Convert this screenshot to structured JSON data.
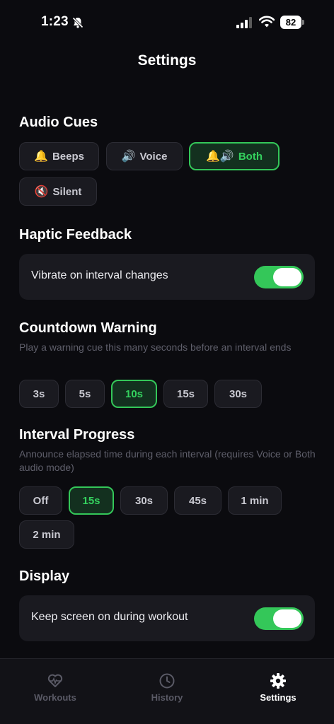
{
  "status_bar": {
    "time": "1:23",
    "battery": "82"
  },
  "header": {
    "title": "Settings"
  },
  "audio_cues": {
    "title": "Audio Cues",
    "options": [
      {
        "emoji": "🔔",
        "label": "Beeps"
      },
      {
        "emoji": "🔊",
        "label": "Voice"
      },
      {
        "emoji": "🔔🔊",
        "label": "Both"
      },
      {
        "emoji": "🔇",
        "label": "Silent"
      }
    ],
    "selected": "Both"
  },
  "haptic": {
    "title": "Haptic Feedback",
    "label": "Vibrate on interval changes",
    "enabled": true
  },
  "countdown": {
    "title": "Countdown Warning",
    "description": "Play a warning cue this many seconds before an interval ends",
    "options": [
      "3s",
      "5s",
      "10s",
      "15s",
      "30s"
    ],
    "selected": "10s"
  },
  "interval_progress": {
    "title": "Interval Progress",
    "description": "Announce elapsed time during each interval (requires Voice or Both audio mode)",
    "options": [
      "Off",
      "15s",
      "30s",
      "45s",
      "1 min",
      "2 min"
    ],
    "selected": "15s"
  },
  "display": {
    "title": "Display",
    "label": "Keep screen on during workout",
    "enabled": true
  },
  "tabs": [
    {
      "label": "Workouts",
      "icon": "heart-pulse-icon"
    },
    {
      "label": "History",
      "icon": "clock-icon"
    },
    {
      "label": "Settings",
      "icon": "gear-icon"
    }
  ],
  "active_tab": "Settings",
  "colors": {
    "accent": "#34c759",
    "background": "#0b0b0f",
    "card": "#1a1a20"
  }
}
